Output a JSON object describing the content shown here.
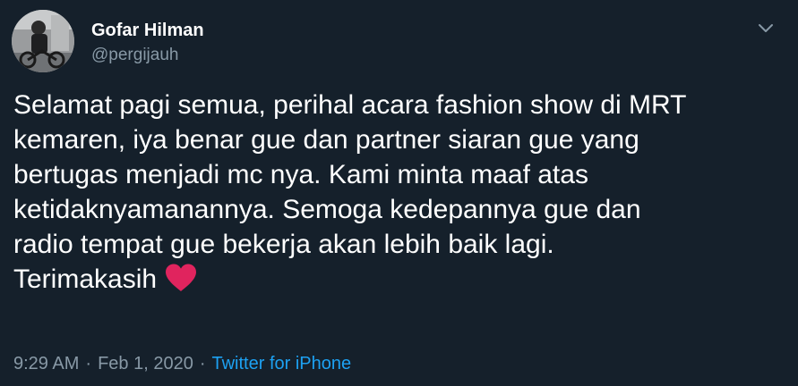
{
  "author": {
    "display_name": "Gofar Hilman",
    "handle": "@pergijauh"
  },
  "tweet": {
    "lines": [
      "Selamat pagi semua, perihal acara fashion show di MRT",
      "kemaren, iya benar gue dan partner siaran gue yang",
      "bertugas menjadi mc nya. Kami minta maaf atas",
      "ketidaknyamanannya. Semoga kedepannya gue dan",
      "radio tempat gue bekerja akan lebih baik lagi.",
      "Terimakasih"
    ],
    "emoji": "red-heart"
  },
  "meta": {
    "time": "9:29 AM",
    "separator": "·",
    "date": "Feb 1, 2020",
    "source": "Twitter for iPhone"
  },
  "icons": {
    "menu": "chevron-down-icon",
    "emoji": "heart-icon"
  },
  "colors": {
    "background": "#15202b",
    "text_primary": "#ffffff",
    "text_secondary": "#8899a6",
    "link": "#1da1f2",
    "heart": "#e0245e"
  }
}
